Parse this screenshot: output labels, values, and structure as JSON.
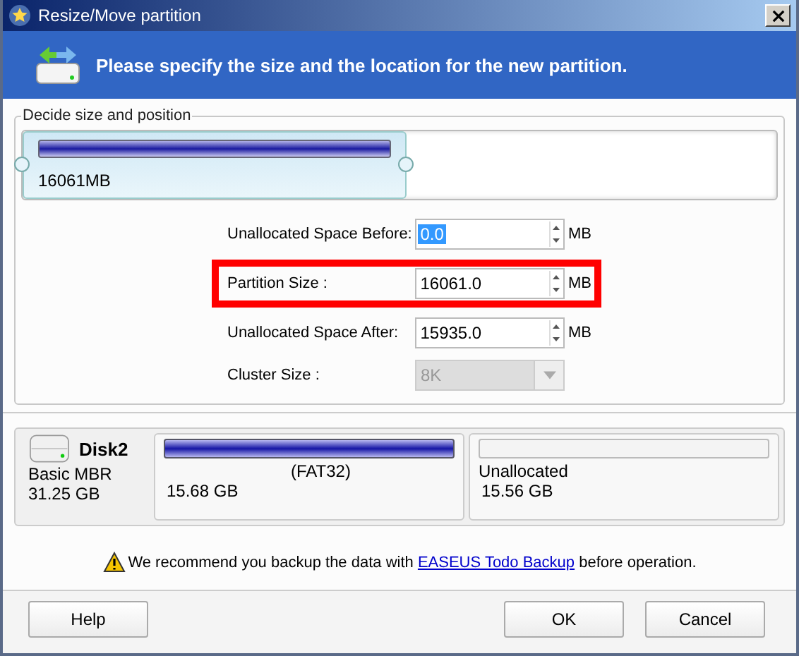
{
  "window": {
    "title": "Resize/Move partition"
  },
  "header": {
    "text": "Please specify the size and the location for the new partition."
  },
  "group": {
    "title": "Decide size and position",
    "map": {
      "label": "16061MB"
    },
    "fields": [
      {
        "kind": "spin",
        "label": "Unallocated Space Before:",
        "value": "0.0",
        "unit": "MB",
        "text_selected": true
      },
      {
        "kind": "spin",
        "label": "Partition Size :",
        "value": "16061.0",
        "unit": "MB",
        "text_selected": false,
        "annotated": true
      },
      {
        "kind": "spin",
        "label": "Unallocated Space After:",
        "value": "15935.0",
        "unit": "MB",
        "text_selected": false
      },
      {
        "kind": "dropdown",
        "label": "Cluster Size :",
        "value": "8K",
        "disabled": true
      }
    ]
  },
  "disk": {
    "name": "Disk2",
    "type": "Basic MBR",
    "size": "31.25 GB",
    "partitions": [
      {
        "kind": "used",
        "label": "(FAT32)",
        "size": "15.68 GB"
      },
      {
        "kind": "unallocated",
        "label": "Unallocated",
        "size": "15.56 GB"
      }
    ]
  },
  "notice": {
    "before": "We recommend you backup the data with ",
    "link": "EASEUS Todo Backup",
    "after": " before operation."
  },
  "buttons": [
    {
      "label": "Help"
    },
    {
      "label": "OK"
    },
    {
      "label": "Cancel"
    }
  ]
}
